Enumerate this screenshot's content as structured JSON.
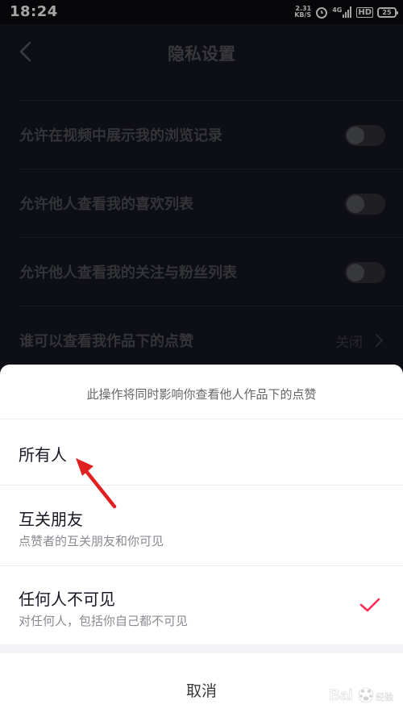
{
  "status_bar": {
    "time": "18:24",
    "net_speed_value": "2.31",
    "net_speed_unit": "KB/S",
    "signal_label": "4G",
    "hd_label": "HD",
    "battery": "25"
  },
  "nav": {
    "title": "隐私设置"
  },
  "settings": [
    {
      "label": "允许在视频中展示我的浏览记录",
      "toggle_on": false
    },
    {
      "label": "允许他人查看我的喜欢列表",
      "toggle_on": false
    },
    {
      "label": "允许他人查看我的关注与粉丝列表",
      "toggle_on": false
    },
    {
      "label": "谁可以查看我作品下的点赞",
      "value": "关闭"
    }
  ],
  "sheet": {
    "hint": "此操作将同时影响你查看他人作品下的点赞",
    "options": [
      {
        "title": "所有人",
        "subtitle": ""
      },
      {
        "title": "互关朋友",
        "subtitle": "点赞者的互关朋友和你可见"
      },
      {
        "title": "任何人不可见",
        "subtitle": "对任何人，包括你自己都不可见",
        "selected": true
      }
    ],
    "cancel_label": "取消"
  },
  "colors": {
    "page_bg": "#161823",
    "check_accent": "#fe2c55",
    "annotation_arrow": "#e02020"
  },
  "watermark": "Baidu 经验"
}
